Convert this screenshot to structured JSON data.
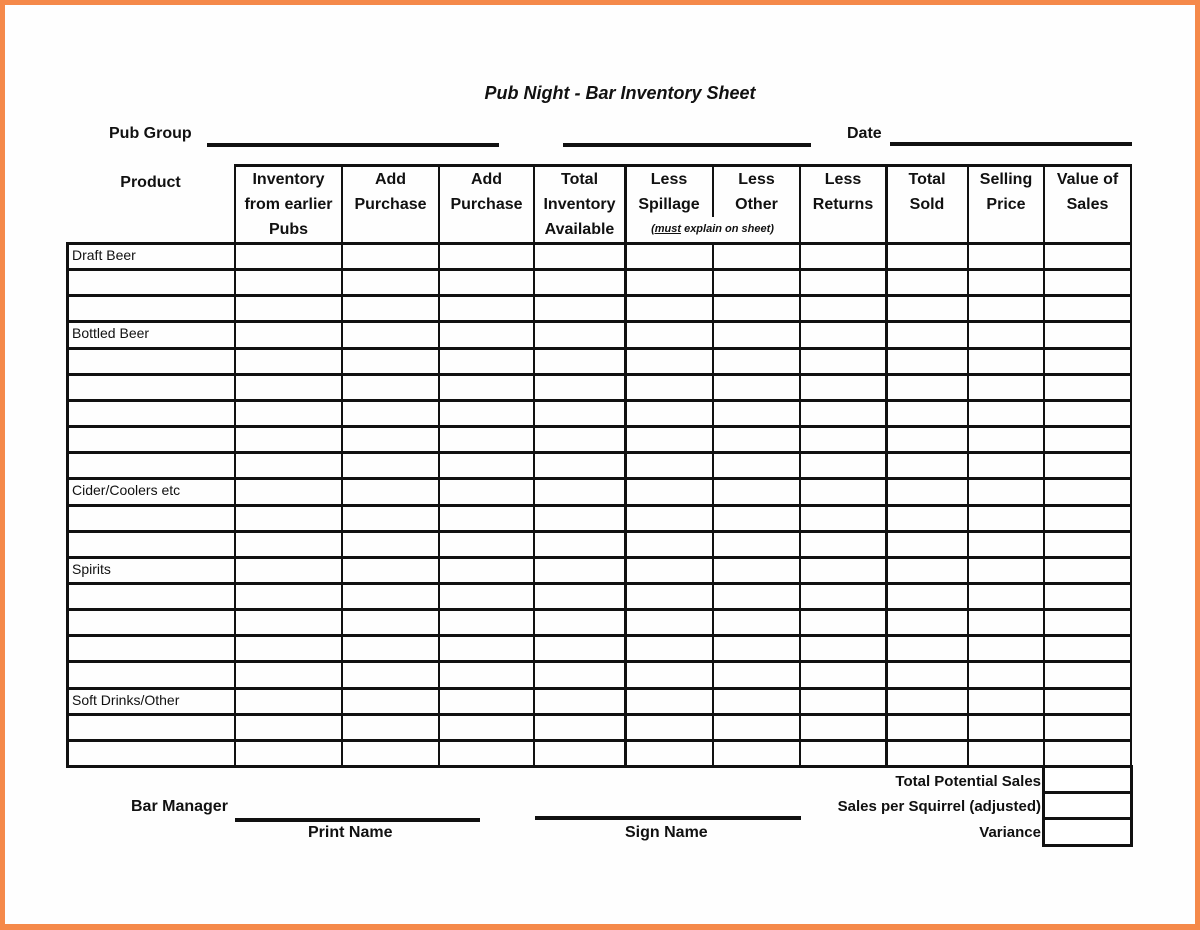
{
  "title": "Pub Night - Bar Inventory Sheet",
  "header_fields": {
    "pub_group_label": "Pub Group",
    "pub_group_value": "",
    "unlabeled_value": "",
    "date_label": "Date",
    "date_value": ""
  },
  "table": {
    "product_header": "Product",
    "columns": [
      {
        "lines": [
          "Inventory",
          "from earlier",
          "Pubs"
        ]
      },
      {
        "lines": [
          "Add",
          "Purchase"
        ]
      },
      {
        "lines": [
          "Add",
          "Purchase"
        ]
      },
      {
        "lines": [
          "Total",
          "Inventory",
          "Available"
        ]
      },
      {
        "lines": [
          "Less",
          "Spillage"
        ]
      },
      {
        "lines": [
          "Less",
          "Other"
        ]
      },
      {
        "lines": [
          "Less",
          "Returns"
        ]
      },
      {
        "lines": [
          "Total",
          "Sold"
        ]
      },
      {
        "lines": [
          "Selling",
          "Price"
        ]
      },
      {
        "lines": [
          "Value of",
          "Sales"
        ]
      }
    ],
    "spillage_note_underlined": "(must",
    "spillage_note_rest": " explain on sheet)",
    "categories": [
      {
        "label": "Draft Beer",
        "rows": 3
      },
      {
        "label": "Bottled Beer",
        "rows": 6
      },
      {
        "label": "Cider/Coolers etc",
        "rows": 3
      },
      {
        "label": "Spirits",
        "rows": 5
      },
      {
        "label": "Soft Drinks/Other",
        "rows": 3
      }
    ]
  },
  "summary": {
    "total_potential_sales_label": "Total Potential Sales",
    "total_potential_sales_value": "",
    "sales_per_squirrel_label": "Sales per Squirrel (adjusted)",
    "sales_per_squirrel_value": "",
    "variance_label": "Variance",
    "variance_value": ""
  },
  "signature": {
    "bar_manager_label": "Bar Manager",
    "print_name_label": "Print Name",
    "sign_name_label": "Sign Name",
    "print_name_value": "",
    "sign_name_value": ""
  },
  "colors": {
    "frame": "#f5894a",
    "ink": "#111111"
  }
}
